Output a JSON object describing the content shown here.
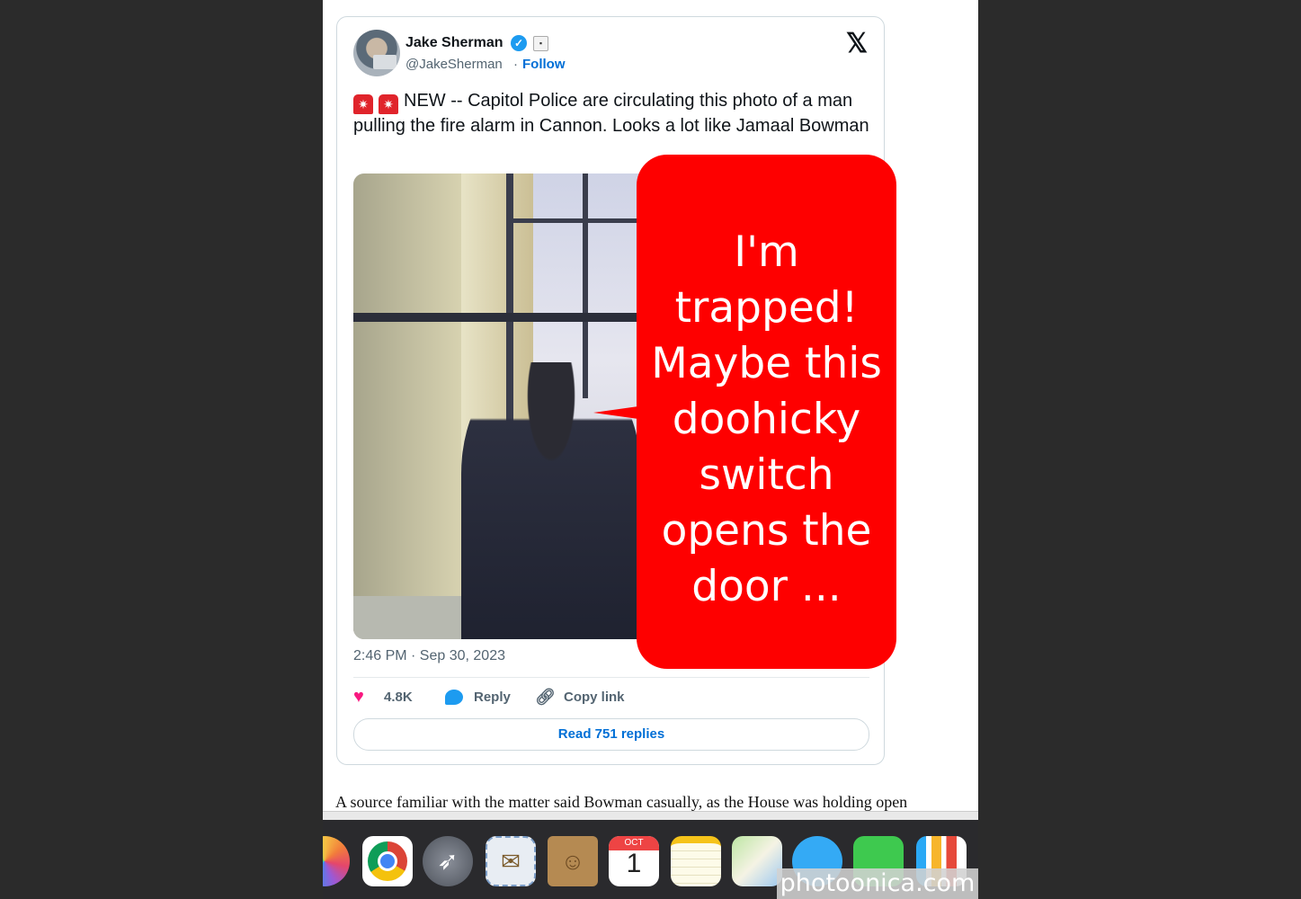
{
  "tweet": {
    "author_name": "Jake Sherman",
    "handle": "@JakeSherman",
    "separator": "·",
    "follow_label": "Follow",
    "text": "NEW -- Capitol Police are circulating this photo of a man pulling the fire alarm in Cannon. Looks a lot like Jamaal Bowman",
    "timestamp": "2:46 PM · Sep 30, 2023",
    "likes": "4.8K",
    "reply_label": "Reply",
    "copy_link_label": "Copy link",
    "read_replies_label": "Read 751 replies"
  },
  "callout": {
    "lines": [
      "I'm",
      "trapped!",
      "Maybe this",
      "doohicky",
      "switch",
      "opens the",
      "door ..."
    ]
  },
  "article": {
    "paragraph": "A source familiar with the matter said Bowman casually, as the House was holding open"
  },
  "dock": {
    "calendar_month": "OCT",
    "calendar_day": "1",
    "icons": [
      "photos-icon",
      "chrome-icon",
      "launchpad-icon",
      "mail-icon",
      "contacts-icon",
      "calendar-icon",
      "notes-icon",
      "maps-icon",
      "messages-icon",
      "facetime-icon",
      "numbers-icon"
    ]
  },
  "watermark": "photoonica.com",
  "colors": {
    "callout": "#fe0000",
    "link": "#006fd6",
    "verified": "#1d9bf0",
    "like": "#f91880"
  }
}
